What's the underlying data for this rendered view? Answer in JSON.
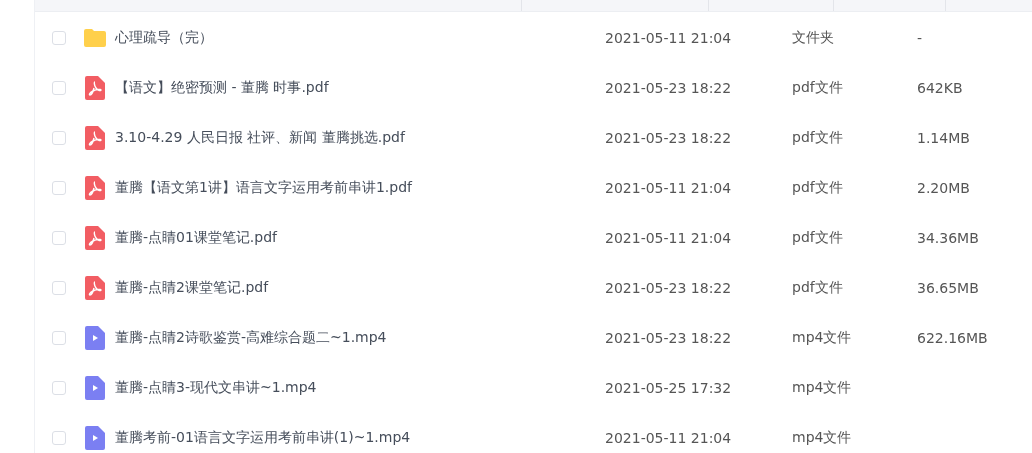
{
  "files": [
    {
      "kind": "folder",
      "checked": false,
      "name": "心理疏导（完）",
      "modified": "2021-05-11 21:04",
      "type": "文件夹",
      "size": "-"
    },
    {
      "kind": "pdf",
      "checked": false,
      "name": "【语文】绝密预测 - 董腾 时事.pdf",
      "modified": "2021-05-23 18:22",
      "type": "pdf文件",
      "size": "642KB"
    },
    {
      "kind": "pdf",
      "checked": false,
      "name": "3.10-4.29 人民日报 社评、新闻 董腾挑选.pdf",
      "modified": "2021-05-23 18:22",
      "type": "pdf文件",
      "size": "1.14MB"
    },
    {
      "kind": "pdf",
      "checked": false,
      "name": "董腾【语文第1讲】语言文字运用考前串讲1.pdf",
      "modified": "2021-05-11 21:04",
      "type": "pdf文件",
      "size": "2.20MB"
    },
    {
      "kind": "pdf",
      "checked": false,
      "name": "董腾-点睛01课堂笔记.pdf",
      "modified": "2021-05-11 21:04",
      "type": "pdf文件",
      "size": "34.36MB"
    },
    {
      "kind": "pdf",
      "checked": false,
      "name": "董腾-点睛2课堂笔记.pdf",
      "modified": "2021-05-23 18:22",
      "type": "pdf文件",
      "size": "36.65MB"
    },
    {
      "kind": "video",
      "checked": false,
      "name": "董腾-点睛2诗歌鉴赏-高难综合题二~1.mp4",
      "modified": "2021-05-23 18:22",
      "type": "mp4文件",
      "size": "622.16MB"
    },
    {
      "kind": "video",
      "checked": false,
      "name": "董腾-点睛3-现代文串讲~1.mp4",
      "modified": "2021-05-25 17:32",
      "type": "mp4文件"
    },
    {
      "kind": "video",
      "checked": false,
      "name": "董腾考前-01语言文字运用考前串讲(1)~1.mp4",
      "modified": "2021-05-11 21:04",
      "type": "mp4文件"
    }
  ]
}
